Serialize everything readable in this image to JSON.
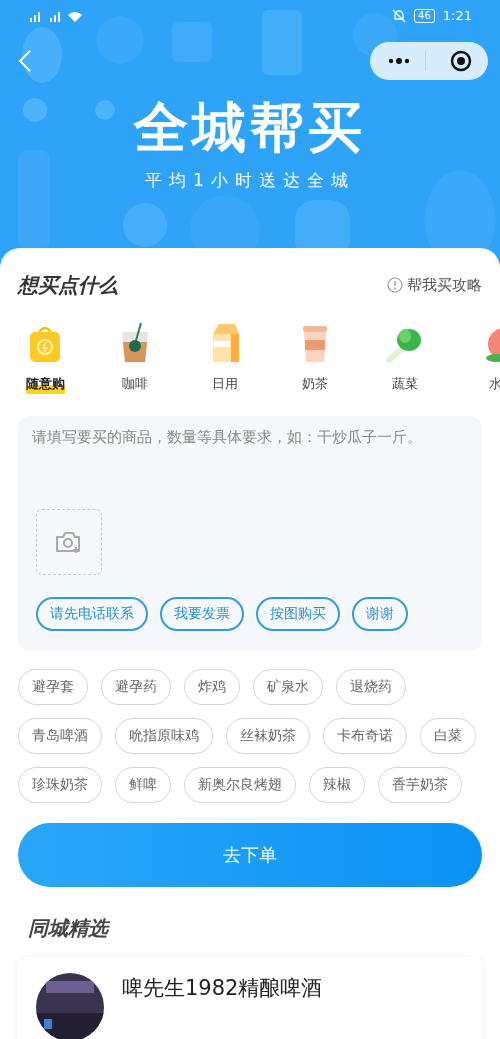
{
  "status_bar": {
    "battery": "46",
    "time": "1:21"
  },
  "header": {
    "title": "全城帮买",
    "subtitle": "平均1小时送达全城"
  },
  "section": {
    "title": "想买点什么",
    "guide_link": "帮我买攻略"
  },
  "categories": [
    {
      "label": "随意购",
      "kind": "bag",
      "selected": true
    },
    {
      "label": "咖啡",
      "kind": "coffee",
      "selected": false
    },
    {
      "label": "日用",
      "kind": "milk",
      "selected": false
    },
    {
      "label": "奶茶",
      "kind": "tea",
      "selected": false
    },
    {
      "label": "蔬菜",
      "kind": "veg",
      "selected": false
    },
    {
      "label": "水",
      "kind": "peach",
      "selected": false
    }
  ],
  "request": {
    "placeholder": "请填写要买的商品，数量等具体要求，如：干炒瓜子一斤。",
    "quick_replies": [
      "请先电话联系",
      "我要发票",
      "按图购买",
      "谢谢"
    ]
  },
  "suggestions": [
    "避孕套",
    "避孕药",
    "炸鸡",
    "矿泉水",
    "退烧药",
    "青岛啤酒",
    "吮指原味鸡",
    "丝袜奶茶",
    "卡布奇诺",
    "白菜",
    "珍珠奶茶",
    "鲜啤",
    "新奥尔良烤翅",
    "辣椒",
    "香芋奶茶"
  ],
  "submit_button": "去下单",
  "featured": {
    "title": "同城精选",
    "items": [
      {
        "name": "啤先生1982精酿啤酒"
      }
    ]
  }
}
